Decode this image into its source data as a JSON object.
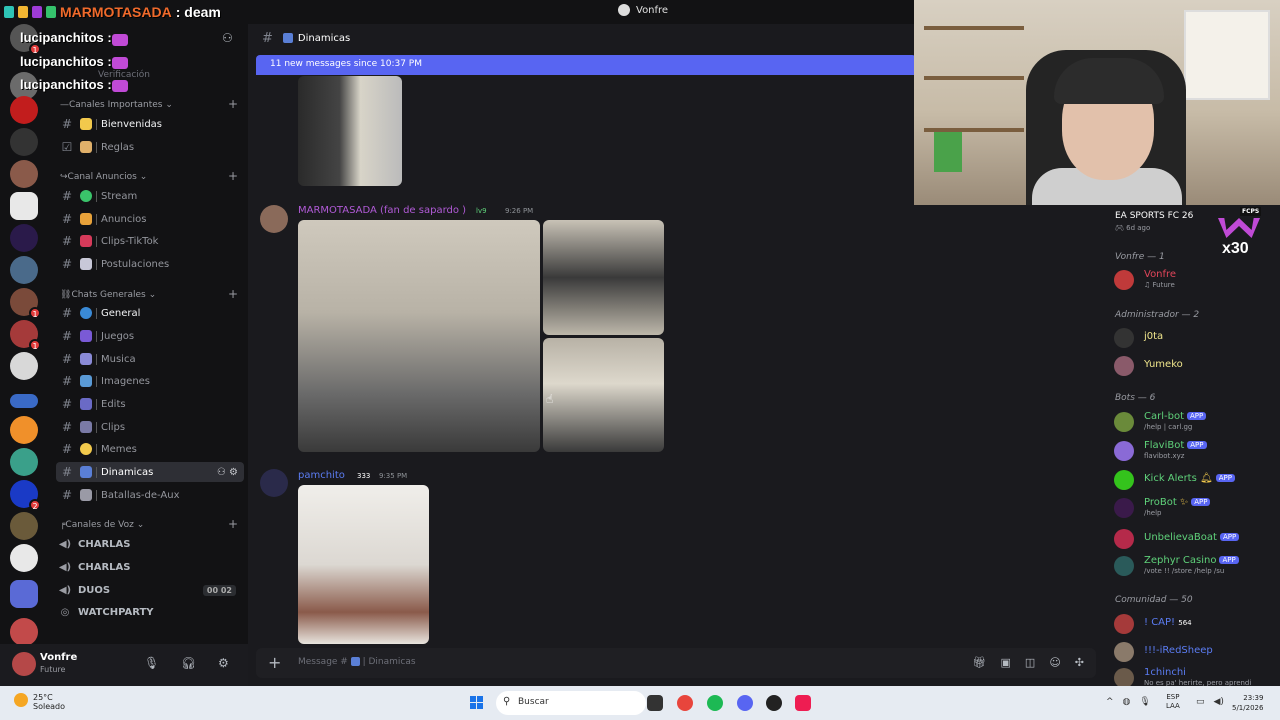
{
  "titlebar": {
    "user": "Vonfre"
  },
  "stream_title": {
    "name": "MARMOTASADA",
    "suffix": ": deam"
  },
  "overlay_names": [
    "lucipanchitos :",
    "lucipanchitos :",
    "lucipanchitos :"
  ],
  "sidebar": {
    "faded_top": "Verificación",
    "categories": [
      "Canales Importantes",
      "Canal Anuncios",
      "Chats Generales",
      "Canales de Voz"
    ],
    "channels": [
      {
        "label": "Bienvenidas"
      },
      {
        "label": "Reglas"
      },
      {
        "label": "Stream"
      },
      {
        "label": "Anuncios"
      },
      {
        "label": "Clips-TikTok"
      },
      {
        "label": "Postulaciones"
      },
      {
        "label": "General"
      },
      {
        "label": "Juegos"
      },
      {
        "label": "Musica"
      },
      {
        "label": "Imagenes"
      },
      {
        "label": "Edits"
      },
      {
        "label": "Clips"
      },
      {
        "label": "Memes"
      },
      {
        "label": "Dinamicas"
      },
      {
        "label": "Batallas-de-Aux"
      }
    ],
    "voice": [
      {
        "label": "CHARLAS"
      },
      {
        "label": "CHARLAS"
      },
      {
        "label": "DUOS",
        "count": "00",
        "limit": "02"
      },
      {
        "label": "WATCHPARTY"
      }
    ]
  },
  "user_panel": {
    "name": "Vonfre",
    "status": "Future"
  },
  "chat": {
    "channel": "Dinamicas",
    "new_messages": "11 new messages since 10:37 PM",
    "messages": [
      {
        "author": "MARMOTASADA (fan de sapardo",
        "level": "lv9",
        "time": "9:26 PM",
        "author_color": "#b05ad6"
      },
      {
        "author": "pamchito",
        "level": "333",
        "time": "9:35 PM",
        "author_color": "#5b7cf2"
      }
    ],
    "composer_placeholder": "Message #",
    "composer_channel": "Dinamicas"
  },
  "activity": {
    "game": "EA SPORTS FC 26",
    "ago": "6d ago",
    "logo": "FCPS",
    "promo": "x30"
  },
  "members": {
    "groups": [
      {
        "label": "Vonfre — 1"
      },
      {
        "label": "Administrador — 2"
      },
      {
        "label": "Bots — 6"
      },
      {
        "label": "Comunidad — 50"
      }
    ],
    "list": [
      {
        "name": "Vonfre",
        "sub": "Future",
        "color": "#e0455a",
        "avatar": "#c03a3a"
      },
      {
        "name": "j0ta",
        "sub": "",
        "color": "#f0e68c",
        "avatar": "#333"
      },
      {
        "name": "Yumeko",
        "sub": "",
        "color": "#f0e68c",
        "avatar": "#8a5a6a"
      },
      {
        "name": "Carl-bot",
        "sub": "/help | carl.gg",
        "color": "#5fd17a",
        "avatar": "#6a8a3a",
        "app": "APP"
      },
      {
        "name": "FlaviBot",
        "sub": "flavibot.xyz",
        "color": "#5fd17a",
        "avatar": "#8a6ad6",
        "app": "APP"
      },
      {
        "name": "Kick Alerts",
        "sub": "",
        "color": "#5fd17a",
        "avatar": "#34c31c",
        "app": "APP"
      },
      {
        "name": "ProBot",
        "sub": "/help",
        "color": "#5fd17a",
        "avatar": "#3a1a4a",
        "app": "APP"
      },
      {
        "name": "UnbelievaBoat",
        "sub": "",
        "color": "#5fd17a",
        "avatar": "#b52a4a",
        "app": "APP"
      },
      {
        "name": "Zephyr Casino",
        "sub": "/vote !! /store /help /su",
        "color": "#5fd17a",
        "avatar": "#2a5a5a",
        "app": "APP"
      },
      {
        "name": "! CAP!",
        "sub": "",
        "color": "#5b7cf2",
        "avatar": "#a53a3a",
        "badge": "564"
      },
      {
        "name": "!!!-iRedSheep",
        "sub": "",
        "color": "#5b7cf2",
        "avatar": "#8a7a6a"
      },
      {
        "name": "1chinchi",
        "sub": "No es pa' herirte, pero aprendi",
        "color": "#5b7cf2",
        "avatar": "#6a5a4a"
      }
    ]
  },
  "taskbar": {
    "temp": "25°C",
    "weather": "Soleado",
    "search": "Buscar",
    "lang1": "ESP",
    "lang2": "LAA",
    "time": "23:39",
    "date": "5/1/2026"
  }
}
